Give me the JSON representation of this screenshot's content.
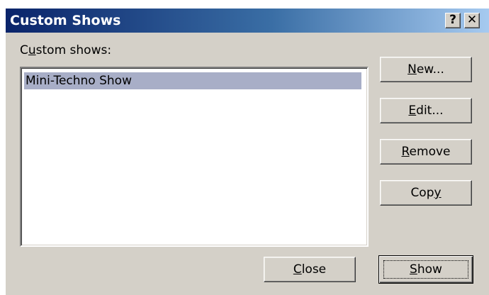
{
  "title": "Custom Shows",
  "title_buttons": {
    "help": "?",
    "close": "✕"
  },
  "list": {
    "label_prefix": "C",
    "label_mnemonic": "u",
    "label_rest": "stom shows:",
    "items": [
      "Mini-Techno Show"
    ],
    "selected_index": 0
  },
  "buttons": {
    "new": {
      "pre": "",
      "key": "N",
      "post": "ew..."
    },
    "edit": {
      "pre": "",
      "key": "E",
      "post": "dit..."
    },
    "remove": {
      "pre": "",
      "key": "R",
      "post": "emove"
    },
    "copy": {
      "pre": "Cop",
      "key": "y",
      "post": ""
    },
    "close": {
      "pre": "",
      "key": "C",
      "post": "lose"
    },
    "show": {
      "pre": "",
      "key": "S",
      "post": "how"
    }
  },
  "colors": {
    "title_start": "#0a246a",
    "title_end": "#a6caf0",
    "face": "#d4d0c8",
    "selection": "#a8aec7"
  }
}
